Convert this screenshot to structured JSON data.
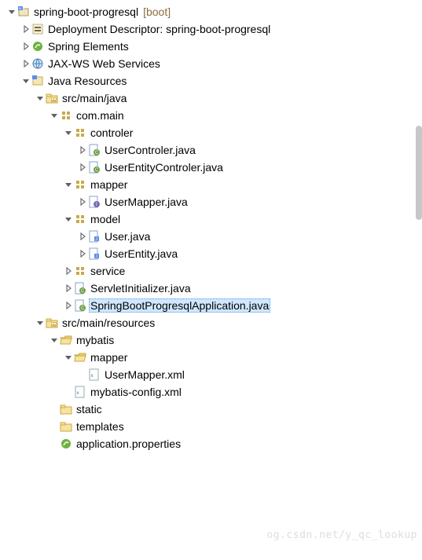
{
  "watermark": "og.csdn.net/y_qc_lookup",
  "nodes": [
    {
      "ind": 0,
      "arrow": "down",
      "icon": "boot-project",
      "label": "spring-boot-progresql",
      "suffix": "[boot]",
      "inter": true
    },
    {
      "ind": 1,
      "arrow": "right",
      "icon": "dd",
      "label": "Deployment Descriptor: spring-boot-progresql",
      "inter": true
    },
    {
      "ind": 1,
      "arrow": "right",
      "icon": "spring",
      "label": "Spring Elements",
      "inter": true
    },
    {
      "ind": 1,
      "arrow": "right",
      "icon": "jaxws",
      "label": "JAX-WS Web Services",
      "inter": true
    },
    {
      "ind": 1,
      "arrow": "down",
      "icon": "java-res",
      "label": "Java Resources",
      "inter": true
    },
    {
      "ind": 2,
      "arrow": "down",
      "icon": "src-folder",
      "label": "src/main/java",
      "inter": true
    },
    {
      "ind": 3,
      "arrow": "down",
      "icon": "package",
      "label": "com.main",
      "inter": true
    },
    {
      "ind": 4,
      "arrow": "down",
      "icon": "package",
      "label": "controler",
      "inter": true
    },
    {
      "ind": 5,
      "arrow": "right",
      "icon": "java-class",
      "label": "UserControler.java",
      "inter": true
    },
    {
      "ind": 5,
      "arrow": "right",
      "icon": "java-class",
      "label": "UserEntityControler.java",
      "inter": true
    },
    {
      "ind": 4,
      "arrow": "down",
      "icon": "package",
      "label": "mapper",
      "inter": true
    },
    {
      "ind": 5,
      "arrow": "right",
      "icon": "java-interface",
      "label": "UserMapper.java",
      "inter": true
    },
    {
      "ind": 4,
      "arrow": "down",
      "icon": "package",
      "label": "model",
      "inter": true
    },
    {
      "ind": 5,
      "arrow": "right",
      "icon": "java-unit",
      "label": "User.java",
      "inter": true
    },
    {
      "ind": 5,
      "arrow": "right",
      "icon": "java-unit",
      "label": "UserEntity.java",
      "inter": true
    },
    {
      "ind": 4,
      "arrow": "right",
      "icon": "package",
      "label": "service",
      "inter": true
    },
    {
      "ind": 4,
      "arrow": "right",
      "icon": "java-class",
      "label": "ServletInitializer.java",
      "inter": true
    },
    {
      "ind": 4,
      "arrow": "right",
      "icon": "java-class",
      "label": "SpringBootProgresqlApplication.java",
      "inter": true,
      "selected": true
    },
    {
      "ind": 2,
      "arrow": "down",
      "icon": "src-folder",
      "label": "src/main/resources",
      "inter": true
    },
    {
      "ind": 3,
      "arrow": "down",
      "icon": "folder-open",
      "label": "mybatis",
      "inter": true
    },
    {
      "ind": 4,
      "arrow": "down",
      "icon": "folder-open",
      "label": "mapper",
      "inter": true
    },
    {
      "ind": 5,
      "arrow": "none",
      "icon": "xml",
      "label": "UserMapper.xml",
      "inter": true
    },
    {
      "ind": 4,
      "arrow": "none",
      "icon": "xml",
      "label": "mybatis-config.xml",
      "inter": true
    },
    {
      "ind": 3,
      "arrow": "none",
      "icon": "folder",
      "label": "static",
      "inter": true
    },
    {
      "ind": 3,
      "arrow": "none",
      "icon": "folder",
      "label": "templates",
      "inter": true
    },
    {
      "ind": 3,
      "arrow": "none",
      "icon": "props",
      "label": "application.properties",
      "inter": true
    }
  ]
}
